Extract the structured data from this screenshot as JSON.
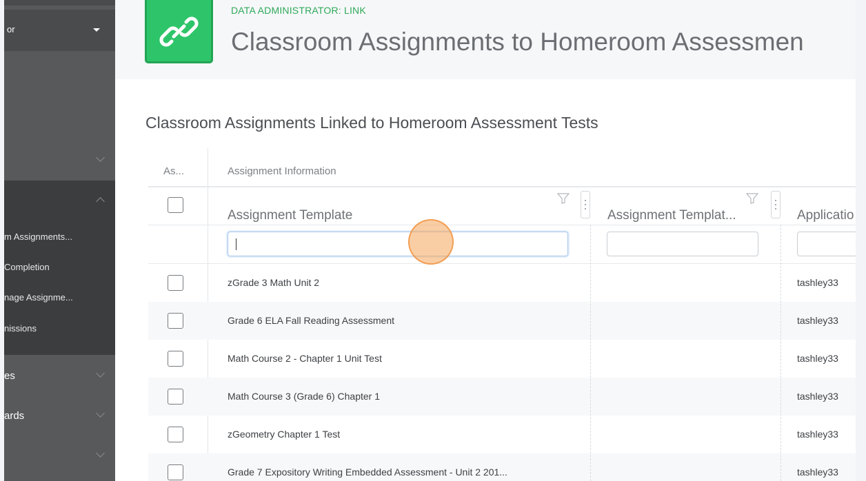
{
  "sidebar": {
    "selector_text": "or",
    "items": [
      {
        "label": "m Assignments..."
      },
      {
        "label": "Completion"
      },
      {
        "label": "nage Assignme..."
      },
      {
        "label": "nissions"
      },
      {
        "label": "es"
      },
      {
        "label": "ards"
      }
    ]
  },
  "header": {
    "eyebrow": "DATA ADMINISTRATOR: LINK",
    "title": "Classroom Assignments to Homeroom Assessmen"
  },
  "main": {
    "section_title": "Classroom Assignments Linked to Homeroom Assessment Tests",
    "column_groups": {
      "as": "As...",
      "info": "Assignment Information"
    },
    "columns": [
      {
        "label": "Assignment Template"
      },
      {
        "label": "Assignment Templat..."
      },
      {
        "label": "Applicatio"
      }
    ],
    "rows": [
      {
        "template": "zGrade 3 Math Unit 2",
        "app": "tashley33"
      },
      {
        "template": "Grade 6 ELA Fall Reading Assessment",
        "app": "tashley33"
      },
      {
        "template": "Math Course 2 - Chapter 1 Unit Test",
        "app": "tashley33"
      },
      {
        "template": "Math Course 3 (Grade 6) Chapter 1",
        "app": "tashley33"
      },
      {
        "template": "zGeometry Chapter 1 Test",
        "app": "tashley33"
      },
      {
        "template": "Grade 7 Expository Writing Embedded Assessment - Unit 2 201...",
        "app": "tashley33"
      }
    ]
  },
  "colors": {
    "accent_green": "#2ec56a",
    "sidebar": "#58595b",
    "click_indicator": "#f6a65a"
  }
}
